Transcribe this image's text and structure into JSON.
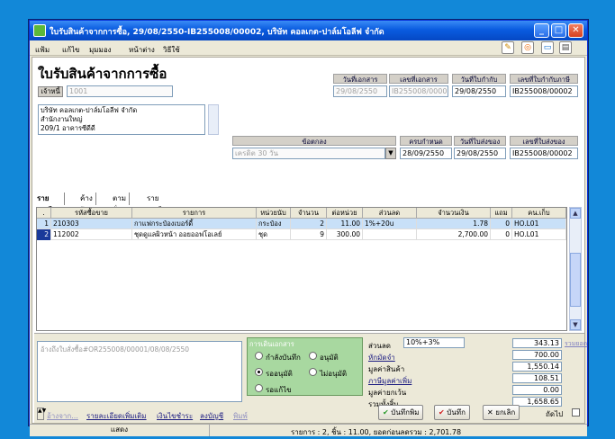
{
  "window": {
    "title": "ใบรับสินค้าจากการซื้อ, 29/08/2550-IB255008/00002, บริษัท คอลเกต-ปาล์มโอลีฟ จำกัด"
  },
  "menu": [
    "แฟ้ม",
    "แก้ไข",
    "มุมมอง",
    "หน้าต่าง",
    "วิธีใช้"
  ],
  "form": {
    "title": "ใบรับสินค้าจากการซื้อ",
    "creditor_label": "เจ้าหนี้",
    "creditor_code": "1001",
    "address": [
      "บริษัท คอลเกต-ปาล์มโอลีฟ จำกัด",
      "สำนักงานใหญ่",
      "209/1 อาคารซีดีดี"
    ],
    "headers1": [
      "วันที่เอกสาร",
      "เลขที่เอกสาร",
      "วันที่ใบกำกับ",
      "เลขที่ใบกำกับภาษี"
    ],
    "values1": [
      "29/08/2550",
      "IB255008/00002",
      "29/08/2550",
      "IB255008/00002"
    ],
    "warehouse_label": "ข้อตกลง",
    "warehouse_value": "เครดิต 30 วัน",
    "headers2": [
      "ครบกำหนด",
      "วันที่ใบส่งของ",
      "เลขที่ใบส่งของ"
    ],
    "values2": [
      "28/09/2550",
      "29/08/2550",
      "IB255008/00002"
    ]
  },
  "tabs": [
    "รายละเอียด",
    "ค้างรับ",
    "ตามสั่ง",
    "รายละเอียดเพิ่มเติม"
  ],
  "grid": {
    "headers": [
      ".",
      "รหัสซื้อขาย",
      "รายการ",
      "หน่วยนับ",
      "จำนวน",
      "ต่อหน่วย",
      "ส่วนลด",
      "จำนวนเงิน",
      "แถม",
      "คน.เก็บ"
    ],
    "rows": [
      {
        "no": "1",
        "code": "210303",
        "name": "กาแฟกระป๋องเบอร์ดี้",
        "unit": "กระป๋อง",
        "qty": "2",
        "price": "11.00",
        "disc": "1%+20u",
        "amount": "1.78",
        "free": "0",
        "loc": "HO.L01"
      },
      {
        "no": "2",
        "code": "112002",
        "name": "ชุดดูแลผิวหน้า ออยออฟโอเลย์",
        "unit": "ชุด",
        "qty": "9",
        "price": "300.00",
        "disc": "",
        "amount": "2,700.00",
        "free": "0",
        "loc": "HO.L01"
      }
    ]
  },
  "remark": "อ้างถึงใบสั่งซื้อ#OR255008/00001/08/08/2550",
  "status": {
    "title": "การเดินเอกสาร",
    "options": [
      "กำลังบันทึก",
      "อนุมัติ",
      "รออนุมัติ",
      "ไม่อนุมัติ",
      "รอแก้ไข"
    ]
  },
  "summary": {
    "discount_label": "ส่วนลด",
    "discount_value": "10%+3%",
    "labels": [
      "ส่วนลด",
      "หักมัดจำ",
      "มูลค่าสินค้า",
      "ภาษีมูลค่าเพิ่ม",
      "มูลค่ายกเว้น",
      "รวมทั้งสิ้น"
    ],
    "values": [
      "343.13",
      "700.00",
      "1,550.14",
      "108.51",
      "0.00",
      "1,658.65"
    ],
    "link": "รวมยอด"
  },
  "bottom_links": [
    "อ้างจาก...",
    "รายละเอียดเพิ่มเติม",
    "เงินไขชำระ",
    "ลงบัญชี",
    "พิมพ์"
  ],
  "buttons": {
    "save_print": "บันทึกพิม",
    "save": "บันทึก",
    "cancel": "ยกเลิก",
    "next": "ถัดไป"
  },
  "statusbar": {
    "left": "แสดง",
    "right": "รายการ : 2, ชิ้น :     11.00, ยอดก่อนลดรวม :   2,701.78"
  }
}
